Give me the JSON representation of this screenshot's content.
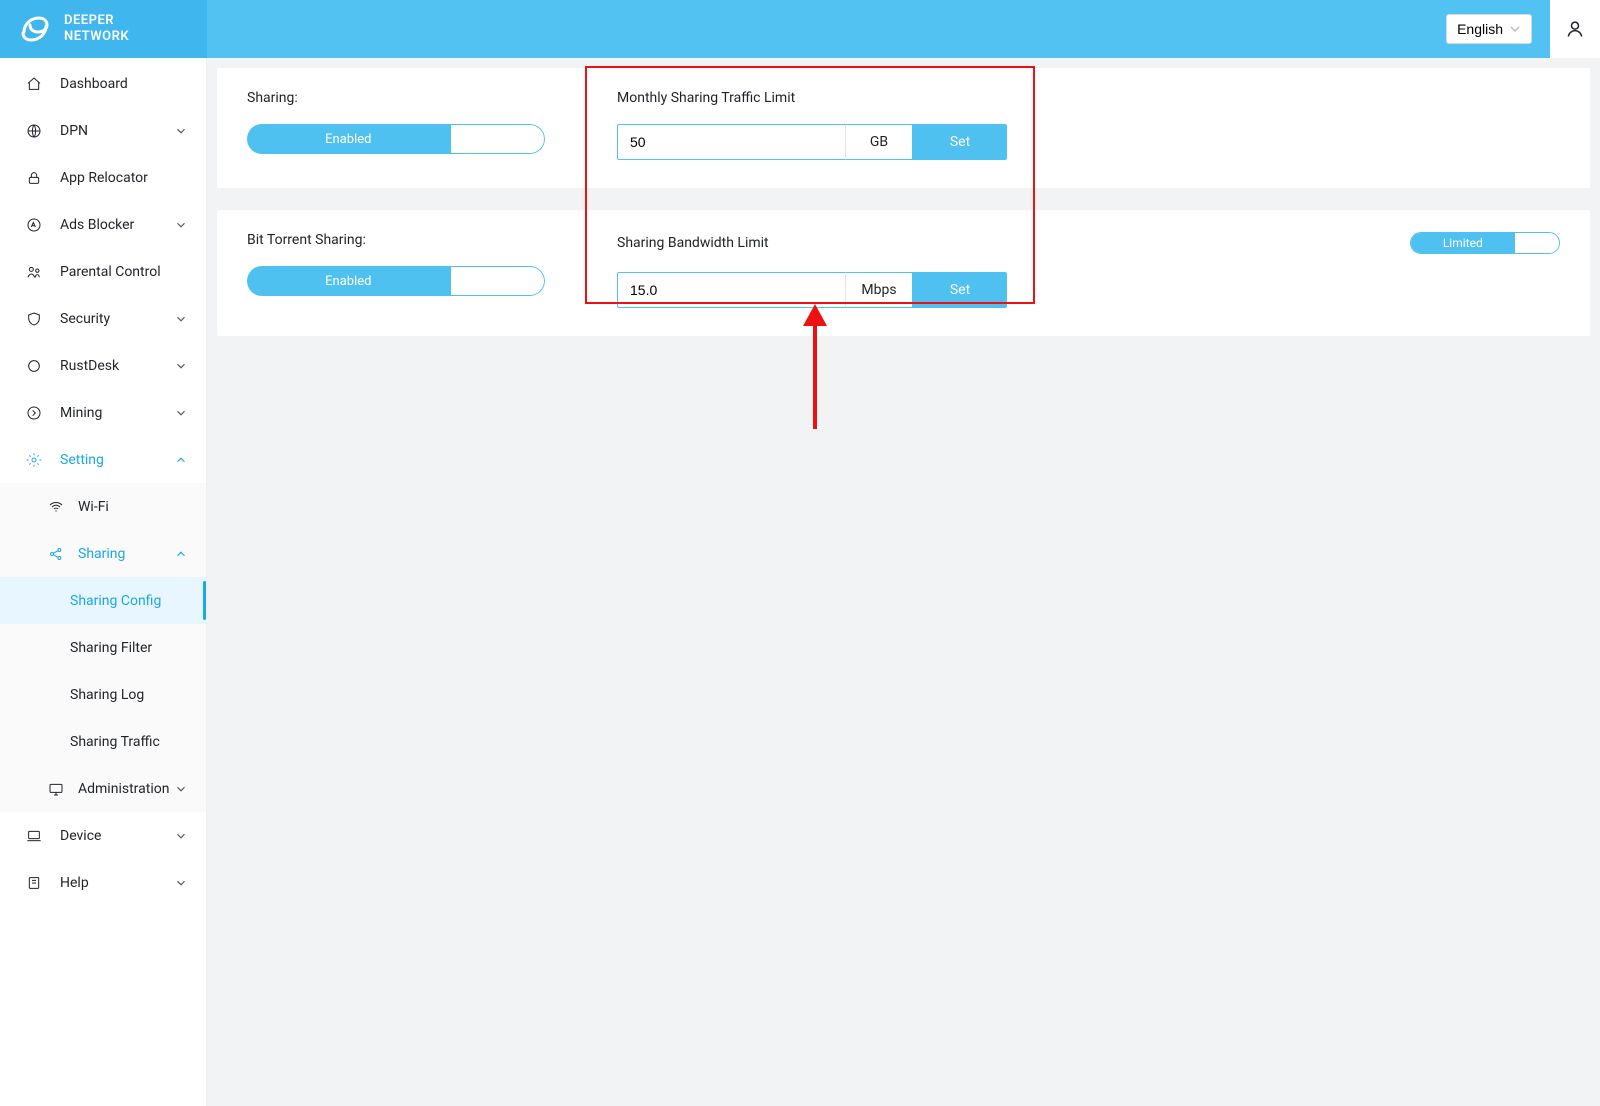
{
  "header": {
    "brand_line1": "DEEPER",
    "brand_line2": "NETWORK",
    "language": "English"
  },
  "sidebar": {
    "items": [
      {
        "label": "Dashboard"
      },
      {
        "label": "DPN"
      },
      {
        "label": "App Relocator"
      },
      {
        "label": "Ads Blocker"
      },
      {
        "label": "Parental Control"
      },
      {
        "label": "Security"
      },
      {
        "label": "RustDesk"
      },
      {
        "label": "Mining"
      },
      {
        "label": "Setting"
      },
      {
        "label": "Device"
      },
      {
        "label": "Help"
      }
    ],
    "setting_children": [
      {
        "label": "Wi-Fi"
      },
      {
        "label": "Sharing"
      },
      {
        "label": "Administration"
      }
    ],
    "sharing_children": [
      {
        "label": "Sharing Config"
      },
      {
        "label": "Sharing Filter"
      },
      {
        "label": "Sharing Log"
      },
      {
        "label": "Sharing Traffic"
      }
    ]
  },
  "panel": {
    "sharing_label": "Sharing:",
    "enabled_label": "Enabled",
    "bittorrent_label": "Bit Torrent Sharing:",
    "traffic_limit_label": "Monthly Sharing Traffic Limit",
    "traffic_limit_value": "50",
    "traffic_limit_unit": "GB",
    "bandwidth_label": "Sharing Bandwidth Limit",
    "bandwidth_value": "15.0",
    "bandwidth_unit": "Mbps",
    "limited_label": "Limited",
    "set_label": "Set"
  }
}
